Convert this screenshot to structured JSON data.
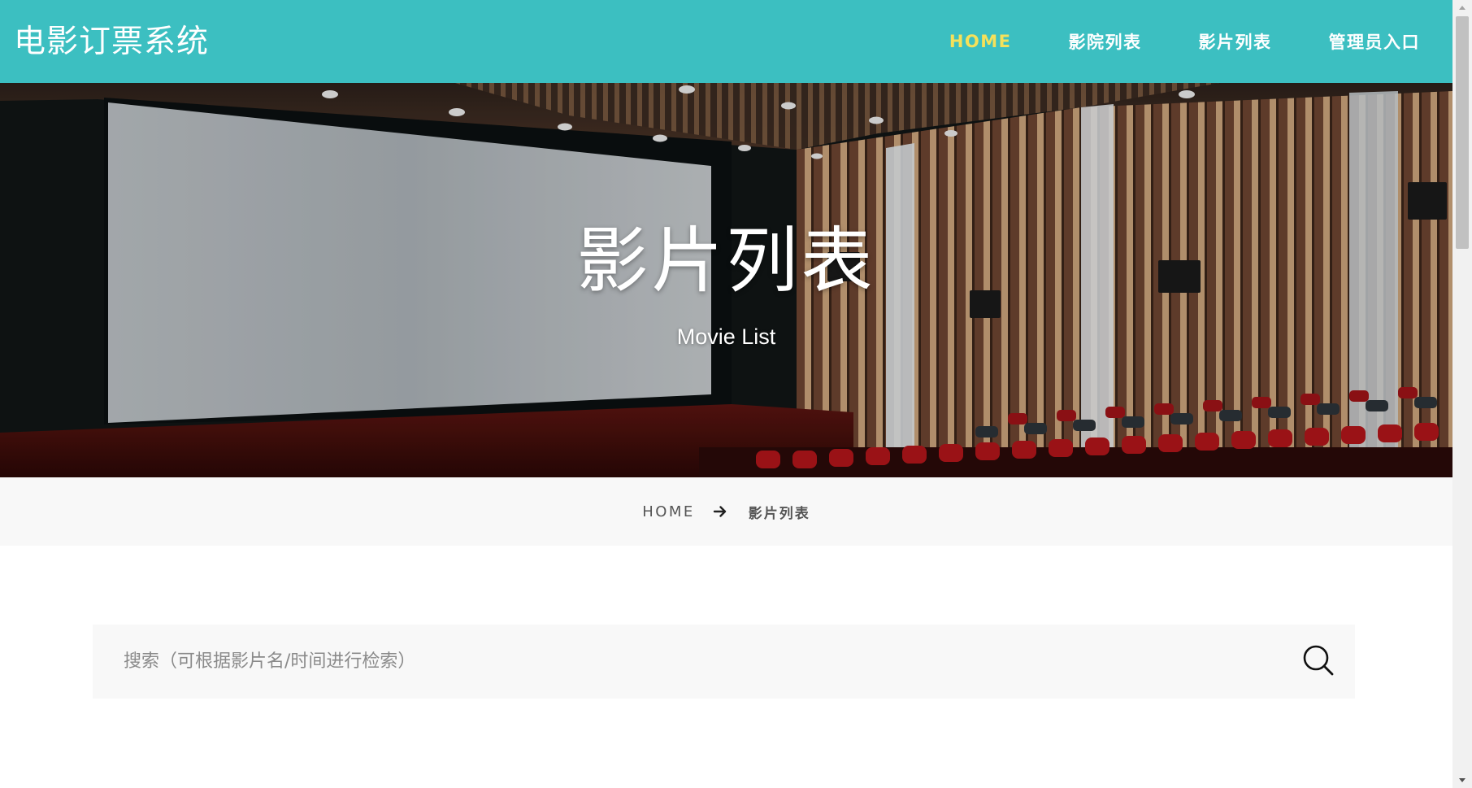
{
  "header": {
    "logo": "电影订票系统",
    "nav": [
      {
        "label": "HOME",
        "active": true
      },
      {
        "label": "影院列表",
        "active": false
      },
      {
        "label": "影片列表",
        "active": false
      },
      {
        "label": "管理员入口",
        "active": false
      }
    ]
  },
  "hero": {
    "title": "影片列表",
    "subtitle": "Movie List",
    "background": "cinema-auditorium-image"
  },
  "breadcrumb": {
    "home": "HOME",
    "separator_icon": "arrow-right-icon",
    "current": "影片列表"
  },
  "search": {
    "placeholder": "搜索（可根据影片名/时间进行检索）",
    "value": "",
    "button_icon": "search-icon"
  },
  "colors": {
    "header_bg": "#3cbfc1",
    "nav_active": "#f5e15a",
    "breadcrumb_bg": "#f8f8f8",
    "search_bg": "#f8f8f8"
  }
}
